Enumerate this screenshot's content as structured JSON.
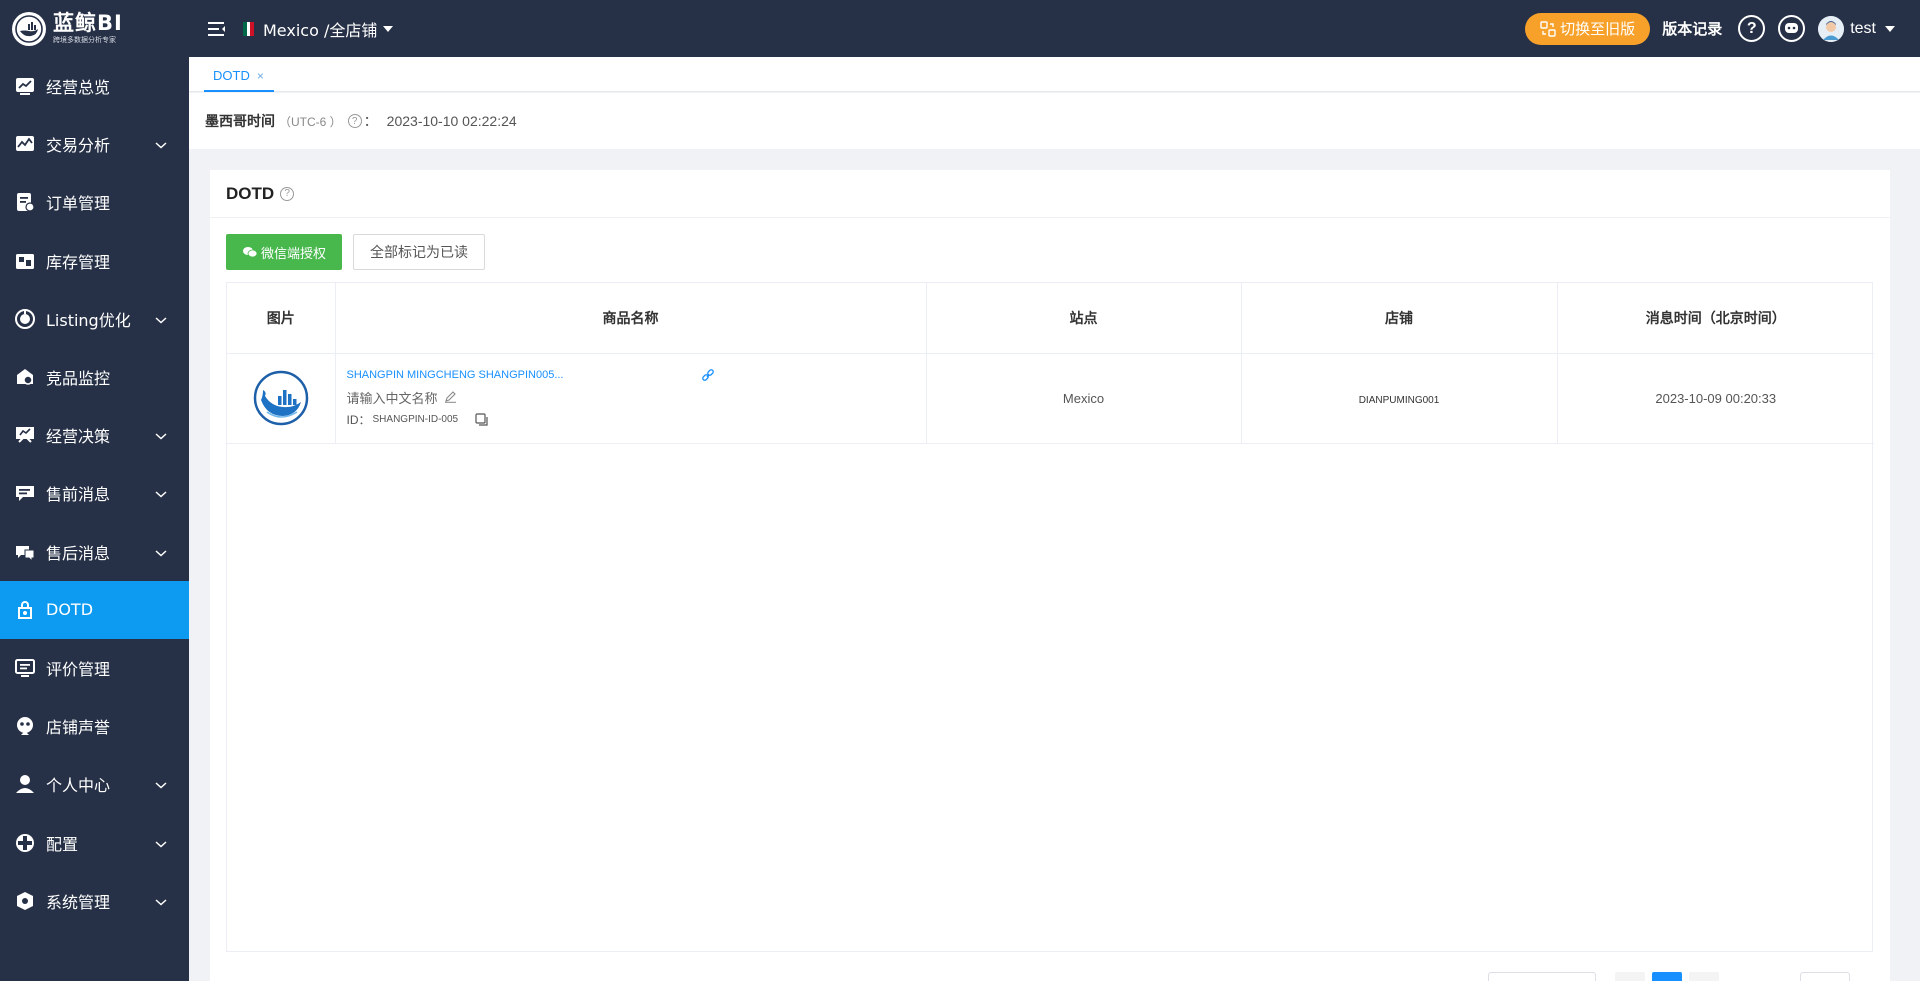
{
  "app": {
    "logo_title": "蓝鲸BI",
    "logo_subtitle": "跨境多数据分析专家"
  },
  "sidebar": {
    "items": [
      {
        "label": "经营总览",
        "icon": "chart-line-icon",
        "has_arrow": false
      },
      {
        "label": "交易分析",
        "icon": "trade-analysis-icon",
        "has_arrow": true
      },
      {
        "label": "订单管理",
        "icon": "order-icon",
        "has_arrow": false
      },
      {
        "label": "库存管理",
        "icon": "inventory-icon",
        "has_arrow": false
      },
      {
        "label": "Listing优化",
        "icon": "listing-icon",
        "has_arrow": true
      },
      {
        "label": "竞品监控",
        "icon": "competitor-icon",
        "has_arrow": false
      },
      {
        "label": "经营决策",
        "icon": "decision-icon",
        "has_arrow": true
      },
      {
        "label": "售前消息",
        "icon": "presale-message-icon",
        "has_arrow": true
      },
      {
        "label": "售后消息",
        "icon": "aftersale-message-icon",
        "has_arrow": true
      },
      {
        "label": "DOTD",
        "icon": "dotd-icon",
        "has_arrow": false,
        "active": true
      },
      {
        "label": "评价管理",
        "icon": "review-icon",
        "has_arrow": false
      },
      {
        "label": "店铺声誉",
        "icon": "reputation-icon",
        "has_arrow": false
      },
      {
        "label": "个人中心",
        "icon": "user-icon",
        "has_arrow": true
      },
      {
        "label": "配置",
        "icon": "config-icon",
        "has_arrow": true
      },
      {
        "label": "系统管理",
        "icon": "system-icon",
        "has_arrow": true
      }
    ]
  },
  "header": {
    "region": "Mexico /全店铺",
    "switch_label": "切换至旧版",
    "version_label": "版本记录",
    "help_label": "?",
    "username": "test"
  },
  "tabs": [
    {
      "label": "DOTD",
      "close": "×"
    }
  ],
  "timebar": {
    "label": "墨西哥时间",
    "timezone": "（UTC-6 ）",
    "help": "?",
    "colon": "：",
    "value": "2023-10-10 02:22:24"
  },
  "card": {
    "title": "DOTD",
    "help": "?",
    "wechat_button": "微信端授权",
    "mark_read_button": "全部标记为已读"
  },
  "table": {
    "columns": [
      "图片",
      "商品名称",
      "站点",
      "店铺",
      "消息时间（北京时间）"
    ],
    "rows": [
      {
        "product_name": "SHANGPIN MINGCHENG SHANGPIN005...",
        "cn_placeholder": "请输入中文名称",
        "id_label": "ID：",
        "id_value": "SHANGPIN-ID-005",
        "site": "Mexico",
        "store": "DIANPUMING001",
        "time": "2023-10-09 00:20:33"
      }
    ]
  },
  "colors": {
    "sidebar_bg": "#263046",
    "active": "#0d9bf2",
    "switch_orange": "#f7a12a",
    "wechat_green": "#48b84d",
    "link_blue": "#1890ff"
  }
}
